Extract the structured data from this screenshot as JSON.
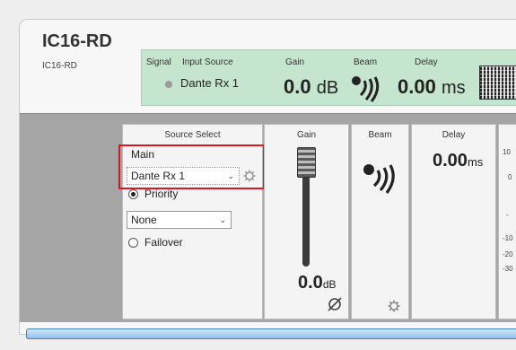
{
  "device": {
    "title": "IC16-RD",
    "subtitle": "IC16-RD"
  },
  "summary": {
    "signal_label": "Signal",
    "input_source_label": "Input Source",
    "input_source_value": "Dante Rx 1",
    "gain_label": "Gain",
    "gain_value": "0.0",
    "gain_unit": "dB",
    "beam_label": "Beam",
    "delay_label": "Delay",
    "delay_value": "0.00",
    "delay_unit": "ms"
  },
  "source_select": {
    "title": "Source Select",
    "main_label": "Main",
    "main_value": "Dante Rx 1",
    "priority_label": "Priority",
    "priority_value": "None",
    "failover_label": "Failover"
  },
  "gain_card": {
    "title": "Gain",
    "value": "0.0",
    "unit": "dB"
  },
  "beam_card": {
    "title": "Beam"
  },
  "delay_card": {
    "title": "Delay",
    "value": "0.00",
    "unit": "ms"
  },
  "meter_scale": [
    "10",
    "0",
    "-",
    "-10",
    "-20",
    "-30"
  ],
  "colors": {
    "summary_bg": "#c5e5cf",
    "highlight": "#e0141c",
    "progress": "#8fbfe9"
  }
}
